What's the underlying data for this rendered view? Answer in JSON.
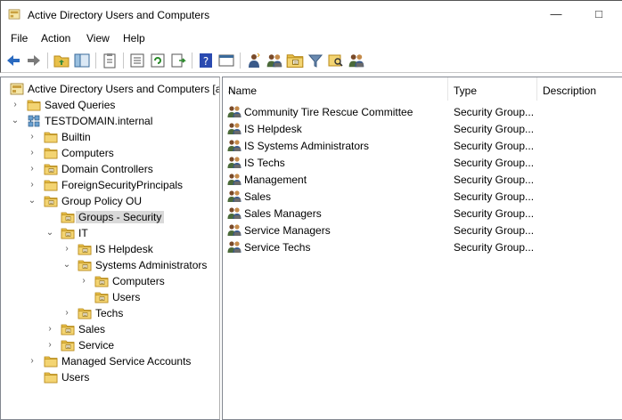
{
  "window": {
    "title": "Active Directory Users and Computers"
  },
  "menu": {
    "file": "File",
    "action": "Action",
    "view": "View",
    "help": "Help"
  },
  "tree": {
    "root": "Active Directory Users and Computers [a",
    "saved_queries": "Saved Queries",
    "domain": "TESTDOMAIN.internal",
    "builtin": "Builtin",
    "computers": "Computers",
    "domain_controllers": "Domain Controllers",
    "foreign": "ForeignSecurityPrincipals",
    "group_policy_ou": "Group Policy OU",
    "groups_security": "Groups - Security",
    "it": "IT",
    "is_helpdesk": "IS Helpdesk",
    "systems_admins": "Systems Administrators",
    "sa_computers": "Computers",
    "sa_users": "Users",
    "techs": "Techs",
    "sales": "Sales",
    "service": "Service",
    "managed_service_accounts": "Managed Service Accounts",
    "users": "Users"
  },
  "list": {
    "headers": {
      "name": "Name",
      "type": "Type",
      "description": "Description"
    },
    "rows": [
      {
        "name": "Community Tire Rescue Committee",
        "type": "Security Group..."
      },
      {
        "name": "IS Helpdesk",
        "type": "Security Group..."
      },
      {
        "name": "IS Systems Administrators",
        "type": "Security Group..."
      },
      {
        "name": "IS Techs",
        "type": "Security Group..."
      },
      {
        "name": "Management",
        "type": "Security Group..."
      },
      {
        "name": "Sales",
        "type": "Security Group..."
      },
      {
        "name": "Sales Managers",
        "type": "Security Group..."
      },
      {
        "name": "Service Managers",
        "type": "Security Group..."
      },
      {
        "name": "Service Techs",
        "type": "Security Group..."
      }
    ]
  },
  "colors": {
    "folder": "#e8c04a",
    "folder_dark": "#c99a1f",
    "selected": "#d9d9d9"
  }
}
